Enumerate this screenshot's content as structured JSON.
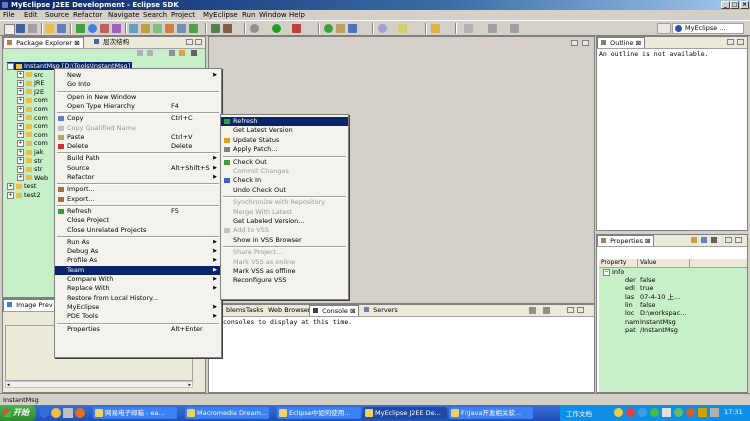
{
  "window": {
    "title": "MyEclipse J2EE Development - Eclipse SDK"
  },
  "menubar": [
    "File",
    "Edit",
    "Source",
    "Refactor",
    "Navigate",
    "Search",
    "Project",
    "MyEclipse",
    "Run",
    "Window",
    "Help"
  ],
  "perspective": {
    "label": "MyEclipse ..."
  },
  "package_explorer": {
    "tabs": [
      "Package Explorer",
      "层次结构"
    ],
    "rows": [
      {
        "label": "InstantMsg [D:\\Tools\\InstantMsg]",
        "indent": 0
      },
      {
        "label": "src",
        "indent": 1
      },
      {
        "label": "JRE",
        "indent": 1
      },
      {
        "label": "J2E",
        "indent": 1
      },
      {
        "label": "com",
        "indent": 1
      },
      {
        "label": "com",
        "indent": 1
      },
      {
        "label": "com",
        "indent": 1
      },
      {
        "label": "com",
        "indent": 1
      },
      {
        "label": "com",
        "indent": 1
      },
      {
        "label": "com",
        "indent": 1
      },
      {
        "label": "jak",
        "indent": 1
      },
      {
        "label": "str",
        "indent": 1
      },
      {
        "label": "str",
        "indent": 1
      },
      {
        "label": "Web",
        "indent": 1
      },
      {
        "label": "test",
        "indent": 0
      },
      {
        "label": "test2",
        "indent": 0
      }
    ]
  },
  "context_menu": [
    {
      "label": "New",
      "submenu": true
    },
    {
      "label": "Go Into"
    },
    {
      "sep": true
    },
    {
      "label": "Open in New Window"
    },
    {
      "label": "Open Type Hierarchy",
      "shortcut": "F4"
    },
    {
      "sep": true
    },
    {
      "label": "Copy",
      "shortcut": "Ctrl+C",
      "icon": "copy-icon"
    },
    {
      "label": "Copy Qualified Name",
      "disabled": true,
      "icon": "copy-icon"
    },
    {
      "label": "Paste",
      "shortcut": "Ctrl+V",
      "icon": "paste-icon"
    },
    {
      "label": "Delete",
      "shortcut": "Delete",
      "icon": "delete-icon"
    },
    {
      "sep": true
    },
    {
      "label": "Build Path",
      "submenu": true
    },
    {
      "label": "Source",
      "shortcut": "Alt+Shift+S",
      "submenu": true
    },
    {
      "label": "Refactor",
      "submenu": true
    },
    {
      "sep": true
    },
    {
      "label": "Import...",
      "icon": "import-icon"
    },
    {
      "label": "Export...",
      "icon": "export-icon"
    },
    {
      "sep": true
    },
    {
      "label": "Refresh",
      "shortcut": "F5",
      "icon": "refresh-icon"
    },
    {
      "label": "Close Project"
    },
    {
      "label": "Close Unrelated Projects"
    },
    {
      "sep": true
    },
    {
      "label": "Run As",
      "submenu": true
    },
    {
      "label": "Debug As",
      "submenu": true
    },
    {
      "label": "Profile As",
      "submenu": true
    },
    {
      "label": "Team",
      "submenu": true,
      "highlighted": true
    },
    {
      "label": "Compare With",
      "submenu": true
    },
    {
      "label": "Replace With",
      "submenu": true
    },
    {
      "label": "Restore from Local History..."
    },
    {
      "label": "MyEclipse",
      "submenu": true
    },
    {
      "label": "PDE Tools",
      "submenu": true
    },
    {
      "sep": true
    },
    {
      "label": "Properties",
      "shortcut": "Alt+Enter"
    }
  ],
  "team_menu": [
    {
      "label": "Refresh",
      "highlighted": true,
      "icon": "refresh-icon"
    },
    {
      "label": "Get Latest Version"
    },
    {
      "label": "Update Status",
      "icon": "update-icon"
    },
    {
      "label": "Apply Patch...",
      "icon": "patch-icon"
    },
    {
      "sep": true
    },
    {
      "label": "Check Out",
      "icon": "checkout-icon"
    },
    {
      "label": "Commit Changes",
      "disabled": true
    },
    {
      "label": "Check In",
      "icon": "checkin-icon"
    },
    {
      "label": "Undo Check Out"
    },
    {
      "sep": true
    },
    {
      "label": "Synchronize with Repository",
      "disabled": true
    },
    {
      "label": "Merge With Latest",
      "disabled": true
    },
    {
      "label": "Get Labeled Version..."
    },
    {
      "label": "Add to VSS",
      "disabled": true,
      "icon": "add-icon"
    },
    {
      "label": "Show in VSS Browser"
    },
    {
      "sep": true
    },
    {
      "label": "Share Project...",
      "disabled": true
    },
    {
      "label": "Mark VSS as online",
      "disabled": true
    },
    {
      "label": "Mark VSS as offline"
    },
    {
      "label": "Reconfigure VSS"
    }
  ],
  "image_preview": {
    "tab": "Image Prev"
  },
  "bottom_tabs": [
    "blems",
    "Tasks",
    "Web Browser",
    "Console",
    "Servers"
  ],
  "console": {
    "message": "consoles to display at this time."
  },
  "outline": {
    "tab": "Outline",
    "message": "An outline is not available."
  },
  "properties": {
    "tab": "Properties",
    "columns": [
      "Property",
      "Value"
    ],
    "group": "Info",
    "rows": [
      {
        "property": "der",
        "value": "false"
      },
      {
        "property": "edi",
        "value": "true"
      },
      {
        "property": "las",
        "value": "07-4-10 上..."
      },
      {
        "property": "lin",
        "value": "false"
      },
      {
        "property": "loc",
        "value": "D:\\workspac..."
      },
      {
        "property": "nam",
        "value": "InstantMsg"
      },
      {
        "property": "pat",
        "value": "/InstantMsg"
      }
    ]
  },
  "statusbar": {
    "text": "InstantMsg"
  },
  "taskbar": {
    "start": "开始",
    "tasks": [
      "网易电子邮箱 - ea...",
      "Macromedia Dream...",
      "Eclipse中如何使用...",
      "MyEclipse J2EE De...",
      "F:\\Java开发相关软..."
    ],
    "tray_label": "工作文档",
    "clock": "17:31"
  }
}
